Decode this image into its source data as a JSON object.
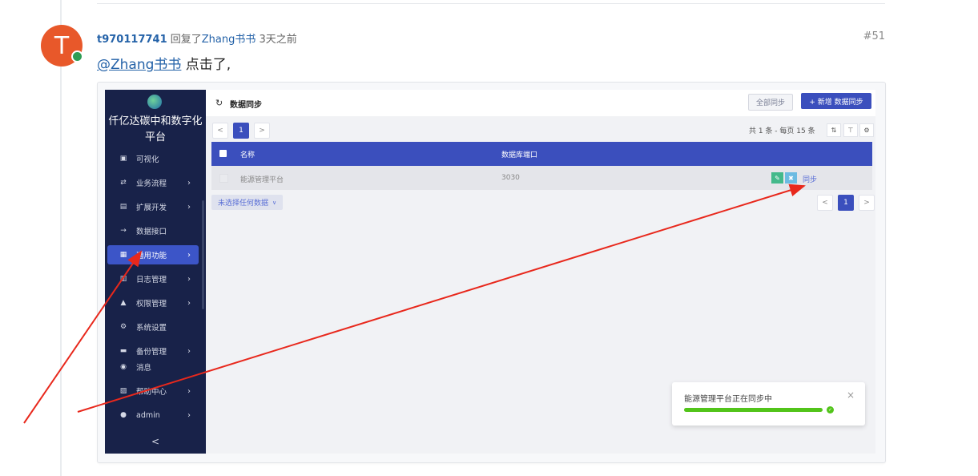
{
  "post": {
    "avatar_letter": "T",
    "username": "t970117741",
    "replied_label": "回复了",
    "reply_to": "Zhang书书",
    "time_ago": "3天之前",
    "post_number": "#51",
    "mention": "@Zhang书书",
    "text": " 点击了,"
  },
  "screenshot": {
    "app_title_line1": "仟亿达碳中和数字化",
    "app_title_line2": "平台",
    "nav": [
      {
        "label": "可视化",
        "icon": "monitor-icon",
        "has_chevron": false
      },
      {
        "label": "业务流程",
        "icon": "flow-icon",
        "has_chevron": true
      },
      {
        "label": "扩展开发",
        "icon": "extension-icon",
        "has_chevron": true
      },
      {
        "label": "数据接口",
        "icon": "plug-icon",
        "has_chevron": false
      },
      {
        "label": "通用功能",
        "icon": "grid-icon",
        "has_chevron": true,
        "active": true
      },
      {
        "label": "日志管理",
        "icon": "log-icon",
        "has_chevron": true
      },
      {
        "label": "权限管理",
        "icon": "lock-icon",
        "has_chevron": true
      },
      {
        "label": "系统设置",
        "icon": "gear-icon",
        "has_chevron": false
      },
      {
        "label": "备份管理",
        "icon": "backup-icon",
        "has_chevron": true
      },
      {
        "label": "消息",
        "icon": "message-icon",
        "has_chevron": false
      },
      {
        "label": "帮助中心",
        "icon": "help-icon",
        "has_chevron": true
      },
      {
        "label": "admin",
        "icon": "user-icon",
        "has_chevron": true
      }
    ],
    "collapse_glyph": "<",
    "page_title": "数据同步",
    "btn_sync_all": "全部同步",
    "btn_new": "+ 新增 数据同步",
    "page_current": "1",
    "prev_glyph": "<",
    "next_glyph": ">",
    "total_text": "共 1 条 - 每页 15 条",
    "table": {
      "headers": [
        "名称",
        "数据库端口"
      ],
      "rows": [
        {
          "name": "能源管理平台",
          "port": "3030",
          "action": "同步"
        }
      ]
    },
    "select_info": "未选择任何数据",
    "toast": {
      "message": "能源管理平台正在同步中",
      "progress": 1.0,
      "close": "×"
    }
  }
}
